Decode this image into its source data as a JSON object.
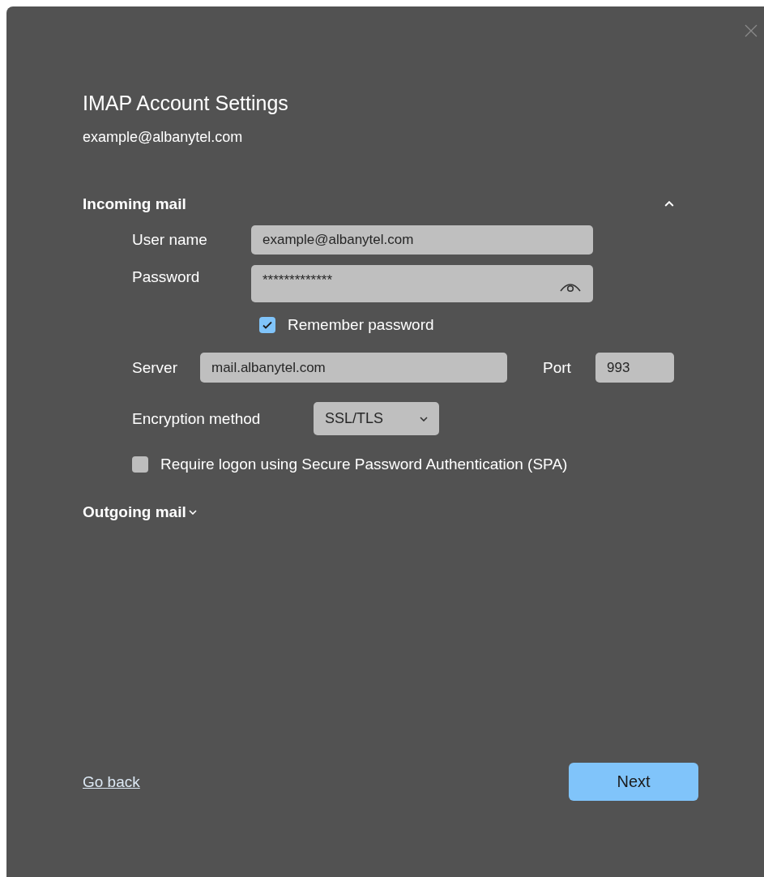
{
  "dialog": {
    "title": "IMAP Account Settings",
    "account_email": "example@albanytel.com"
  },
  "incoming": {
    "title": "Incoming mail",
    "expanded": true,
    "user_name": {
      "label": "User name",
      "value": "example@albanytel.com"
    },
    "password": {
      "label": "Password",
      "value": "*************"
    },
    "remember_password": {
      "label": "Remember password",
      "checked": true
    },
    "server": {
      "label": "Server",
      "value": "mail.albanytel.com"
    },
    "port": {
      "label": "Port",
      "value": "993"
    },
    "encryption": {
      "label": "Encryption method",
      "value": "SSL/TLS"
    },
    "spa": {
      "label": "Require logon using Secure Password Authentication (SPA)",
      "checked": false
    }
  },
  "outgoing": {
    "title": "Outgoing mail",
    "expanded": false
  },
  "footer": {
    "go_back": "Go back",
    "next": "Next"
  }
}
